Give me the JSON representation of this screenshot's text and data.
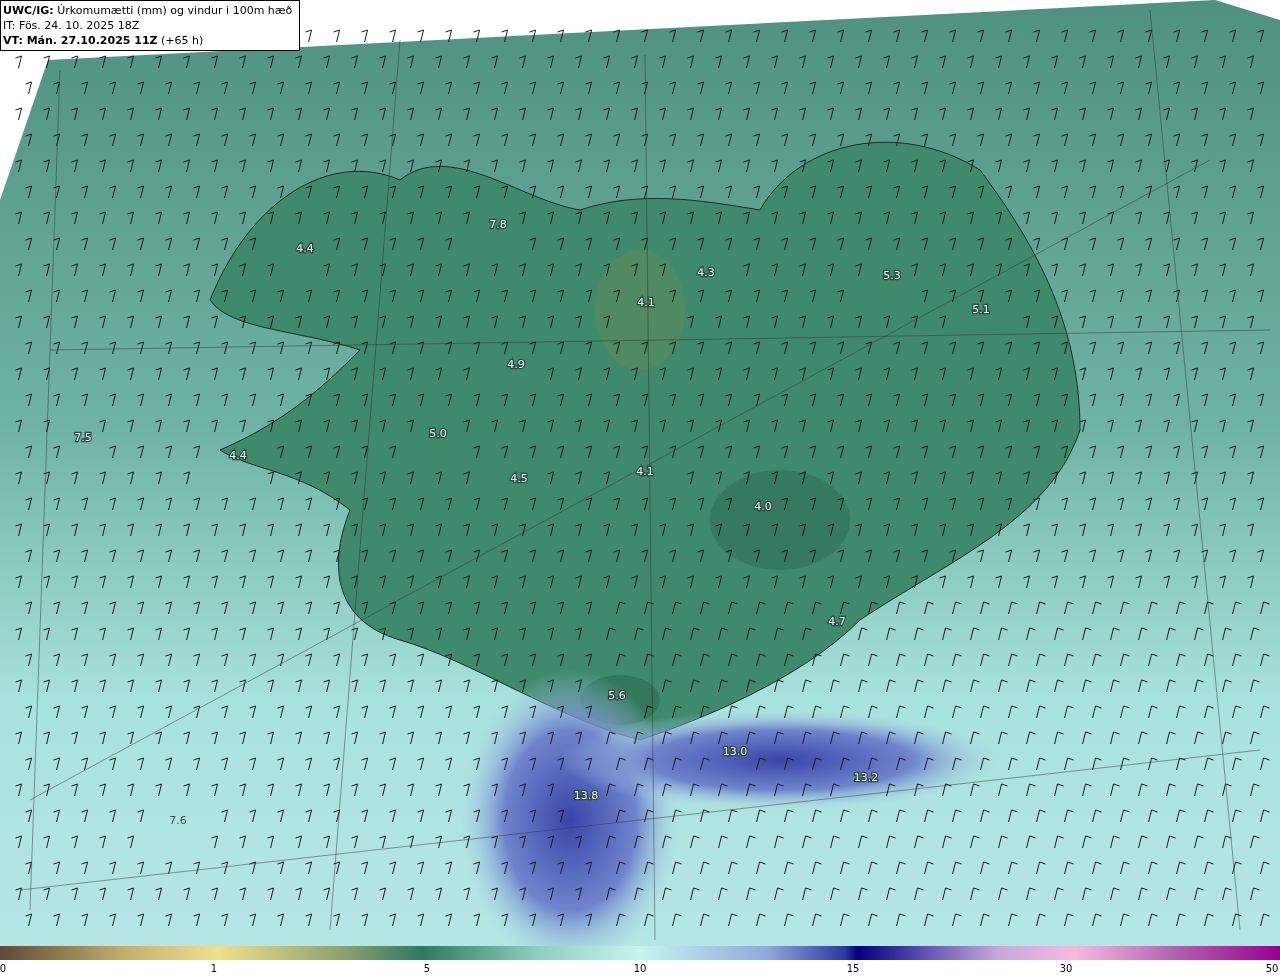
{
  "header": {
    "lines": [
      "**UWC/IG:** Úrkomumætti (mm) og vindur i 100m hæð",
      "IT: Fös. 24. 10. 2025 18Z",
      "**VT: Mán. 27.10.2025 11Z** (+65 h)"
    ]
  },
  "map_labels": [
    "4.4",
    "7.8",
    "4.3",
    "5.3",
    "4.1",
    "5.1",
    "4.9",
    "7.5",
    "5.0",
    "4.4",
    "4.1",
    "4.5",
    "4.0",
    "4.7",
    "5.6",
    "13.0",
    "13.2",
    "13.8",
    "7.6"
  ],
  "colorbar": {
    "ticks": [
      "0",
      "1",
      "5",
      "10",
      "15",
      "30",
      "50"
    ]
  }
}
